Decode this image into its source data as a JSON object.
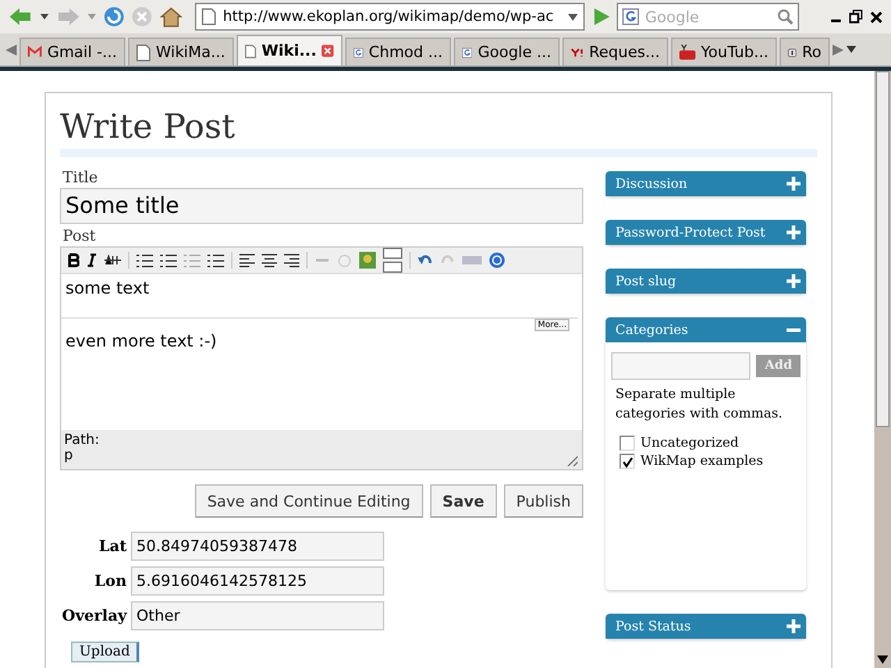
{
  "browser": {
    "url": "http://www.ekoplan.org/wikimap/demo/wp-ac",
    "search_placeholder": "Google"
  },
  "tabs": [
    {
      "label": "Gmail -...",
      "kind": "gmail",
      "selected": false
    },
    {
      "label": "WikiMa...",
      "kind": "page",
      "selected": false
    },
    {
      "label": "Wiki...",
      "kind": "page",
      "selected": true
    },
    {
      "label": "Chmod ...",
      "kind": "google",
      "selected": false
    },
    {
      "label": "Google ...",
      "kind": "google",
      "selected": false
    },
    {
      "label": "Reques...",
      "kind": "yahoo",
      "selected": false
    },
    {
      "label": "YouTub...",
      "kind": "youtube",
      "selected": false
    },
    {
      "label": "Ro",
      "kind": "info",
      "selected": false
    }
  ],
  "page_title": "Write Post",
  "title_field": {
    "label": "Title",
    "value": "Some title"
  },
  "post_editor": {
    "label": "Post",
    "paragraphs": [
      "some text",
      "even more text :-)"
    ],
    "more_label": "More...",
    "path_label": "Path:",
    "path_value": "p"
  },
  "buttons": [
    {
      "label": "Save and Continue Editing",
      "primary": false
    },
    {
      "label": "Save",
      "primary": true
    },
    {
      "label": "Publish",
      "primary": false
    }
  ],
  "fields": [
    {
      "label": "Lat",
      "value": "50.84974059387478"
    },
    {
      "label": "Lon",
      "value": "5.6916046142578125"
    },
    {
      "label": "Overlay",
      "value": "Other"
    }
  ],
  "upload_button": "Upload",
  "sidebar": [
    {
      "title": "Discussion",
      "expanded": false
    },
    {
      "title": "Password-Protect Post",
      "expanded": false
    },
    {
      "title": "Post slug",
      "expanded": false
    },
    {
      "title": "Categories",
      "expanded": true,
      "add_button": "Add",
      "hint": "Separate multiple categories with commas.",
      "categories": [
        {
          "label": "Uncategorized",
          "checked": false
        },
        {
          "label": "WikMap examples",
          "checked": true
        }
      ]
    },
    {
      "title": "Post Status",
      "expanded": false
    }
  ]
}
